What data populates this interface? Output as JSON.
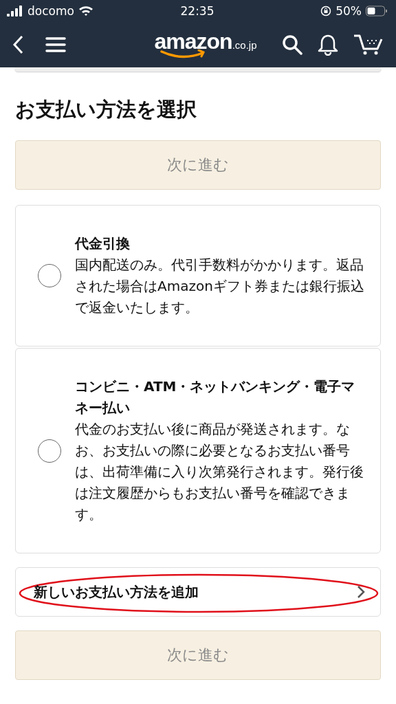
{
  "status_bar": {
    "carrier": "docomo",
    "time": "22:35",
    "battery": "50%"
  },
  "header": {
    "logo": "amazon",
    "logo_suffix": ".co.jp"
  },
  "title": "お支払い方法を選択",
  "next_button_top": "次に進む",
  "payment_options": [
    {
      "title": "代金引換",
      "description": "国内配送のみ。代引手数料がかかります。返品された場合はAmazonギフト券または銀行振込で返金いたします。",
      "selected": false
    },
    {
      "title": "コンビニ・ATM・ネットバンキング・電子マネー払い",
      "description": "代金のお支払い後に商品が発送されます。なお、お支払いの際に必要となるお支払い番号は、出荷準備に入り次第発行されます。発行後は注文履歴からもお支払い番号を確認できます。",
      "selected": false
    }
  ],
  "add_payment": {
    "label": "新しいお支払い方法を追加",
    "highlighted": true
  },
  "next_button_bottom": "次に進む"
}
